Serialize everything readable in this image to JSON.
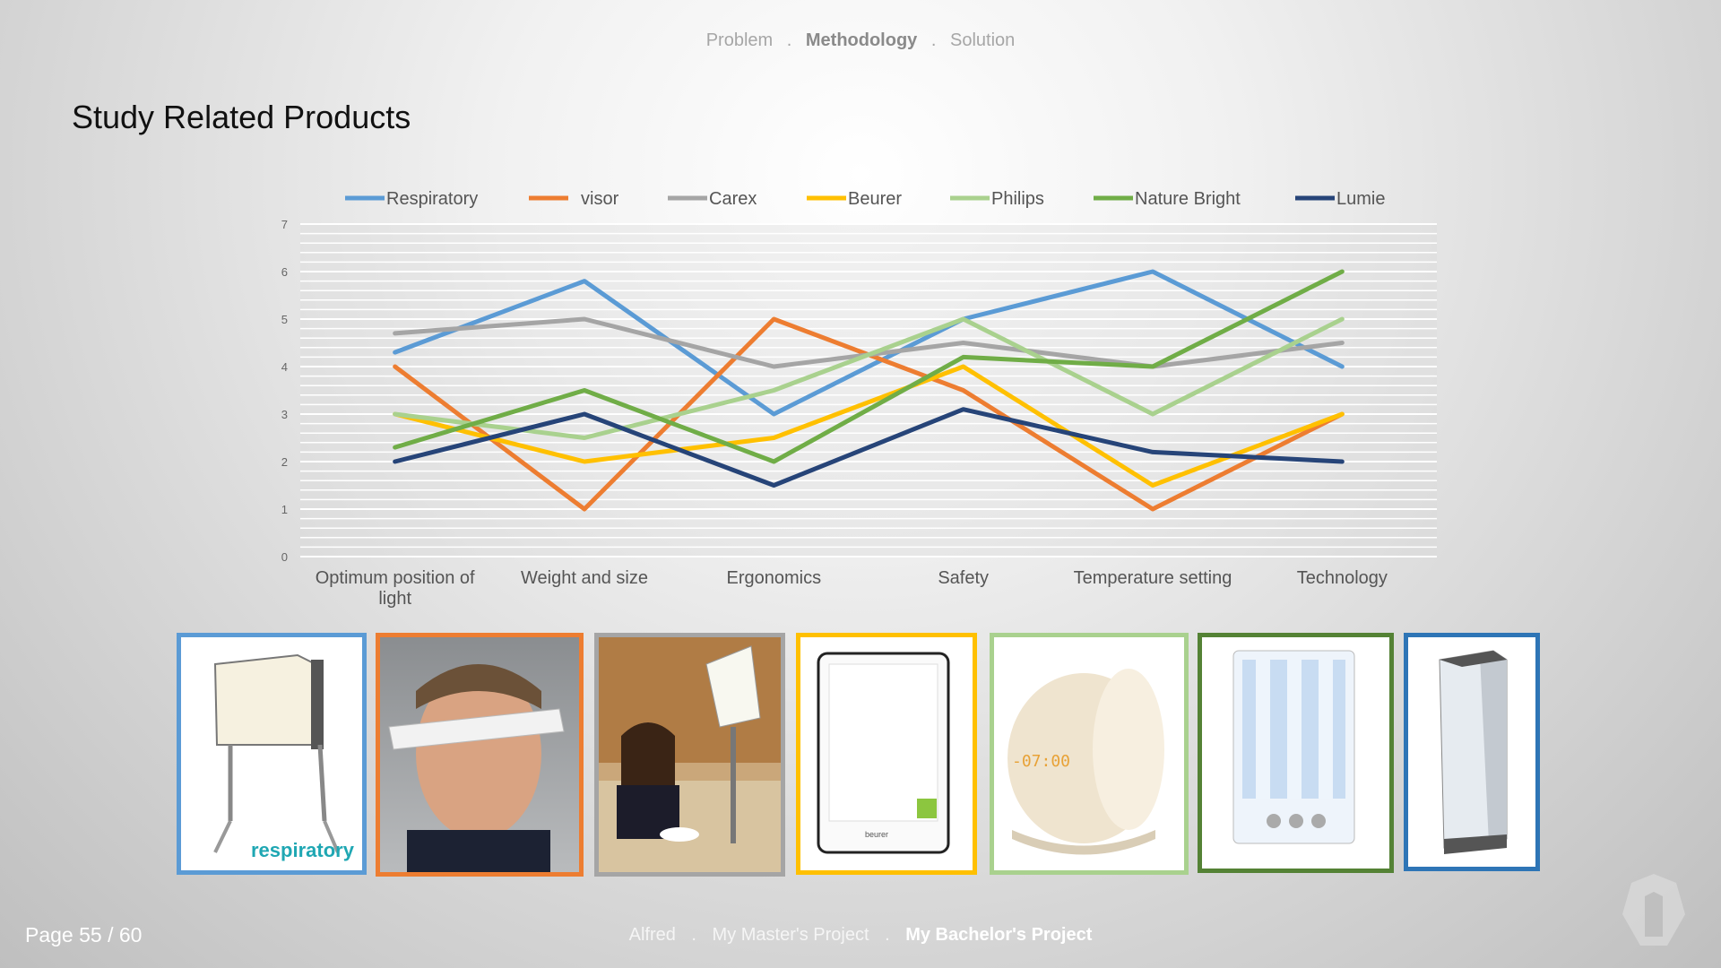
{
  "header": {
    "nav": [
      "Problem",
      "Methodology",
      "Solution"
    ],
    "active_index": 1,
    "separators": [
      ".",
      "."
    ]
  },
  "slide": {
    "title": "Study Related Products"
  },
  "chart_data": {
    "type": "line",
    "categories": [
      "Optimum position of light",
      "Weight and size",
      "Ergonomics",
      "Safety",
      "Temperature setting",
      "Technology"
    ],
    "category_lines": [
      [
        "Optimum position of",
        "light"
      ],
      [
        "Weight and size"
      ],
      [
        "Ergonomics"
      ],
      [
        "Safety"
      ],
      [
        "Temperature setting"
      ],
      [
        "Technology"
      ]
    ],
    "ylim": [
      0,
      7
    ],
    "yticks": [
      0,
      1,
      2,
      3,
      4,
      5,
      6,
      7
    ],
    "legend_position": "top",
    "grid": true,
    "series": [
      {
        "name": "Respiratory",
        "color": "#5b9bd5",
        "values": [
          4.3,
          5.8,
          3,
          5,
          6,
          4
        ]
      },
      {
        "name": "visor",
        "color": "#ed7d31",
        "values": [
          4,
          1,
          5,
          3.5,
          1,
          3
        ]
      },
      {
        "name": "Carex",
        "color": "#a5a5a5",
        "values": [
          4.7,
          5,
          4,
          4.5,
          4,
          4.5
        ]
      },
      {
        "name": "Beurer",
        "color": "#ffc000",
        "values": [
          3,
          2,
          2.5,
          4,
          1.5,
          3
        ]
      },
      {
        "name": "Philips",
        "color": "#a9d18e",
        "values": [
          3,
          2.5,
          3.5,
          5,
          3,
          5
        ]
      },
      {
        "name": "Nature Bright",
        "color": "#70ad47",
        "values": [
          2.3,
          3.5,
          2,
          4.2,
          4,
          6
        ]
      },
      {
        "name": "Lumie",
        "color": "#264478",
        "values": [
          2,
          3,
          1.5,
          3.1,
          2.2,
          2
        ]
      }
    ]
  },
  "products": [
    {
      "name": "Respiratory",
      "border": "#5b9bd5",
      "caption": "respiratory"
    },
    {
      "name": "visor",
      "border": "#ed7d31"
    },
    {
      "name": "Carex",
      "border": "#a5a5a5"
    },
    {
      "name": "Beurer",
      "border": "#ffc000",
      "caption": "beurer"
    },
    {
      "name": "Philips",
      "border": "#a9d18e",
      "caption": "-07:00"
    },
    {
      "name": "Nature Bright",
      "border": "#548235"
    },
    {
      "name": "Lumie",
      "border": "#2e75b6"
    }
  ],
  "footer": {
    "page_label": "Page 55 / 60",
    "nav": [
      "Alfred",
      "My Master's Project",
      "My Bachelor's Project"
    ],
    "active_index": 2,
    "separators": [
      ".",
      "."
    ]
  }
}
